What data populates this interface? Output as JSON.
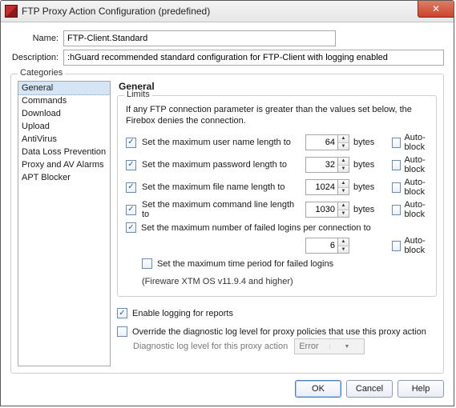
{
  "window": {
    "title": "FTP Proxy Action Configuration (predefined)"
  },
  "form": {
    "name_label": "Name:",
    "name_value": "FTP-Client.Standard",
    "desc_label": "Description:",
    "desc_value": ":hGuard recommended standard configuration for FTP-Client with logging enabled"
  },
  "categories": {
    "legend": "Categories",
    "items": [
      "General",
      "Commands",
      "Download",
      "Upload",
      "AntiVirus",
      "Data Loss Prevention",
      "Proxy and AV Alarms",
      "APT Blocker"
    ]
  },
  "general": {
    "heading": "General",
    "limits_legend": "Limits",
    "note": "If any FTP connection parameter is greater than the values set below, the Firebox denies the connection.",
    "rows": [
      {
        "label": "Set the maximum user name length to",
        "value": "64",
        "unit": "bytes"
      },
      {
        "label": "Set the maximum password length to",
        "value": "32",
        "unit": "bytes"
      },
      {
        "label": "Set the maximum file name length to",
        "value": "1024",
        "unit": "bytes"
      },
      {
        "label": "Set the maximum command line length to",
        "value": "1030",
        "unit": "bytes"
      }
    ],
    "failed_logins_label": "Set the maximum number of failed logins per connection to",
    "failed_logins_value": "6",
    "autoblock_label": "Auto-block",
    "time_period_label": "Set the maximum time period for failed logins",
    "firmware_note": "(Fireware XTM OS v11.9.4 and higher)",
    "enable_logging_label": "Enable logging for reports",
    "override_diag_label": "Override the diagnostic log level for proxy policies that use this proxy action",
    "diag_label": "Diagnostic log level for this proxy action",
    "diag_value": "Error"
  },
  "buttons": {
    "ok": "OK",
    "cancel": "Cancel",
    "help": "Help"
  }
}
